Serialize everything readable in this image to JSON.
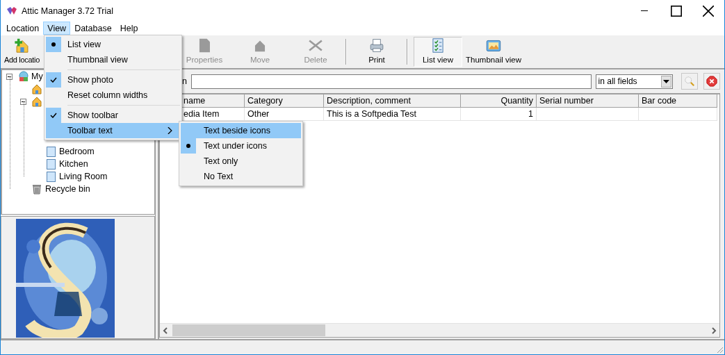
{
  "window": {
    "title": "Attic Manager 3.72 Trial"
  },
  "menu_bar": [
    {
      "label": "Location",
      "selected": false
    },
    {
      "label": "View",
      "selected": true
    },
    {
      "label": "Database",
      "selected": false
    },
    {
      "label": "Help",
      "selected": false
    }
  ],
  "toolbar": [
    {
      "kind": "add",
      "label": "Add locatio",
      "disabled": false,
      "selected": false
    },
    {
      "kind": "properties",
      "label": "Properties",
      "disabled": true,
      "selected": false
    },
    {
      "kind": "move",
      "label": "Move",
      "disabled": true,
      "selected": false
    },
    {
      "kind": "delete",
      "label": "Delete",
      "disabled": true,
      "selected": false
    },
    {
      "kind": "separator"
    },
    {
      "kind": "print",
      "label": "Print",
      "disabled": false,
      "selected": false
    },
    {
      "kind": "separator"
    },
    {
      "kind": "list",
      "label": "List view",
      "disabled": false,
      "selected": true
    },
    {
      "kind": "thumbnail",
      "label": "Thumbnail view",
      "disabled": false,
      "selected": false
    }
  ],
  "tree": [
    {
      "kind": "root",
      "label": "My",
      "expanded": true,
      "children": [
        {
          "kind": "house"
        },
        {
          "kind": "house",
          "expanded": true,
          "children": [
            {
              "kind": "room",
              "label": "Bedroom"
            },
            {
              "kind": "room",
              "label": "Kitchen"
            },
            {
              "kind": "room",
              "label": "Living Room"
            }
          ]
        },
        {
          "kind": "bin",
          "label": "Recycle bin"
        }
      ]
    }
  ],
  "search": {
    "label": "n",
    "scope": "in all fields"
  },
  "table": {
    "columns": [
      "name",
      "Category",
      "Description, comment",
      "Quantity",
      "Serial number",
      "Bar code"
    ],
    "rows": [
      [
        "edia Item",
        "Other",
        "This is a Softpedia Test",
        "1",
        "",
        ""
      ]
    ]
  },
  "view_menu": [
    {
      "kind": "radio",
      "label": "List view",
      "checked": true,
      "selected": false
    },
    {
      "kind": "plain",
      "label": "Thumbnail view",
      "selected": false
    },
    {
      "kind": "separator"
    },
    {
      "kind": "check",
      "label": "Show photo",
      "checked": true,
      "selected": false
    },
    {
      "kind": "plain",
      "label": "Reset column widths",
      "selected": false
    },
    {
      "kind": "separator"
    },
    {
      "kind": "check",
      "label": "Show toolbar",
      "checked": true,
      "selected": false
    },
    {
      "kind": "submenu",
      "label": "Toolbar text",
      "selected": true
    }
  ],
  "toolbar_text_menu": [
    {
      "kind": "radio",
      "label": "Text beside icons",
      "checked": false,
      "selected": true
    },
    {
      "kind": "radio",
      "label": "Text under icons",
      "checked": true,
      "selected": false
    },
    {
      "kind": "radio",
      "label": "Text only",
      "checked": false,
      "selected": false
    },
    {
      "kind": "radio",
      "label": "No Text",
      "checked": false,
      "selected": false
    }
  ]
}
